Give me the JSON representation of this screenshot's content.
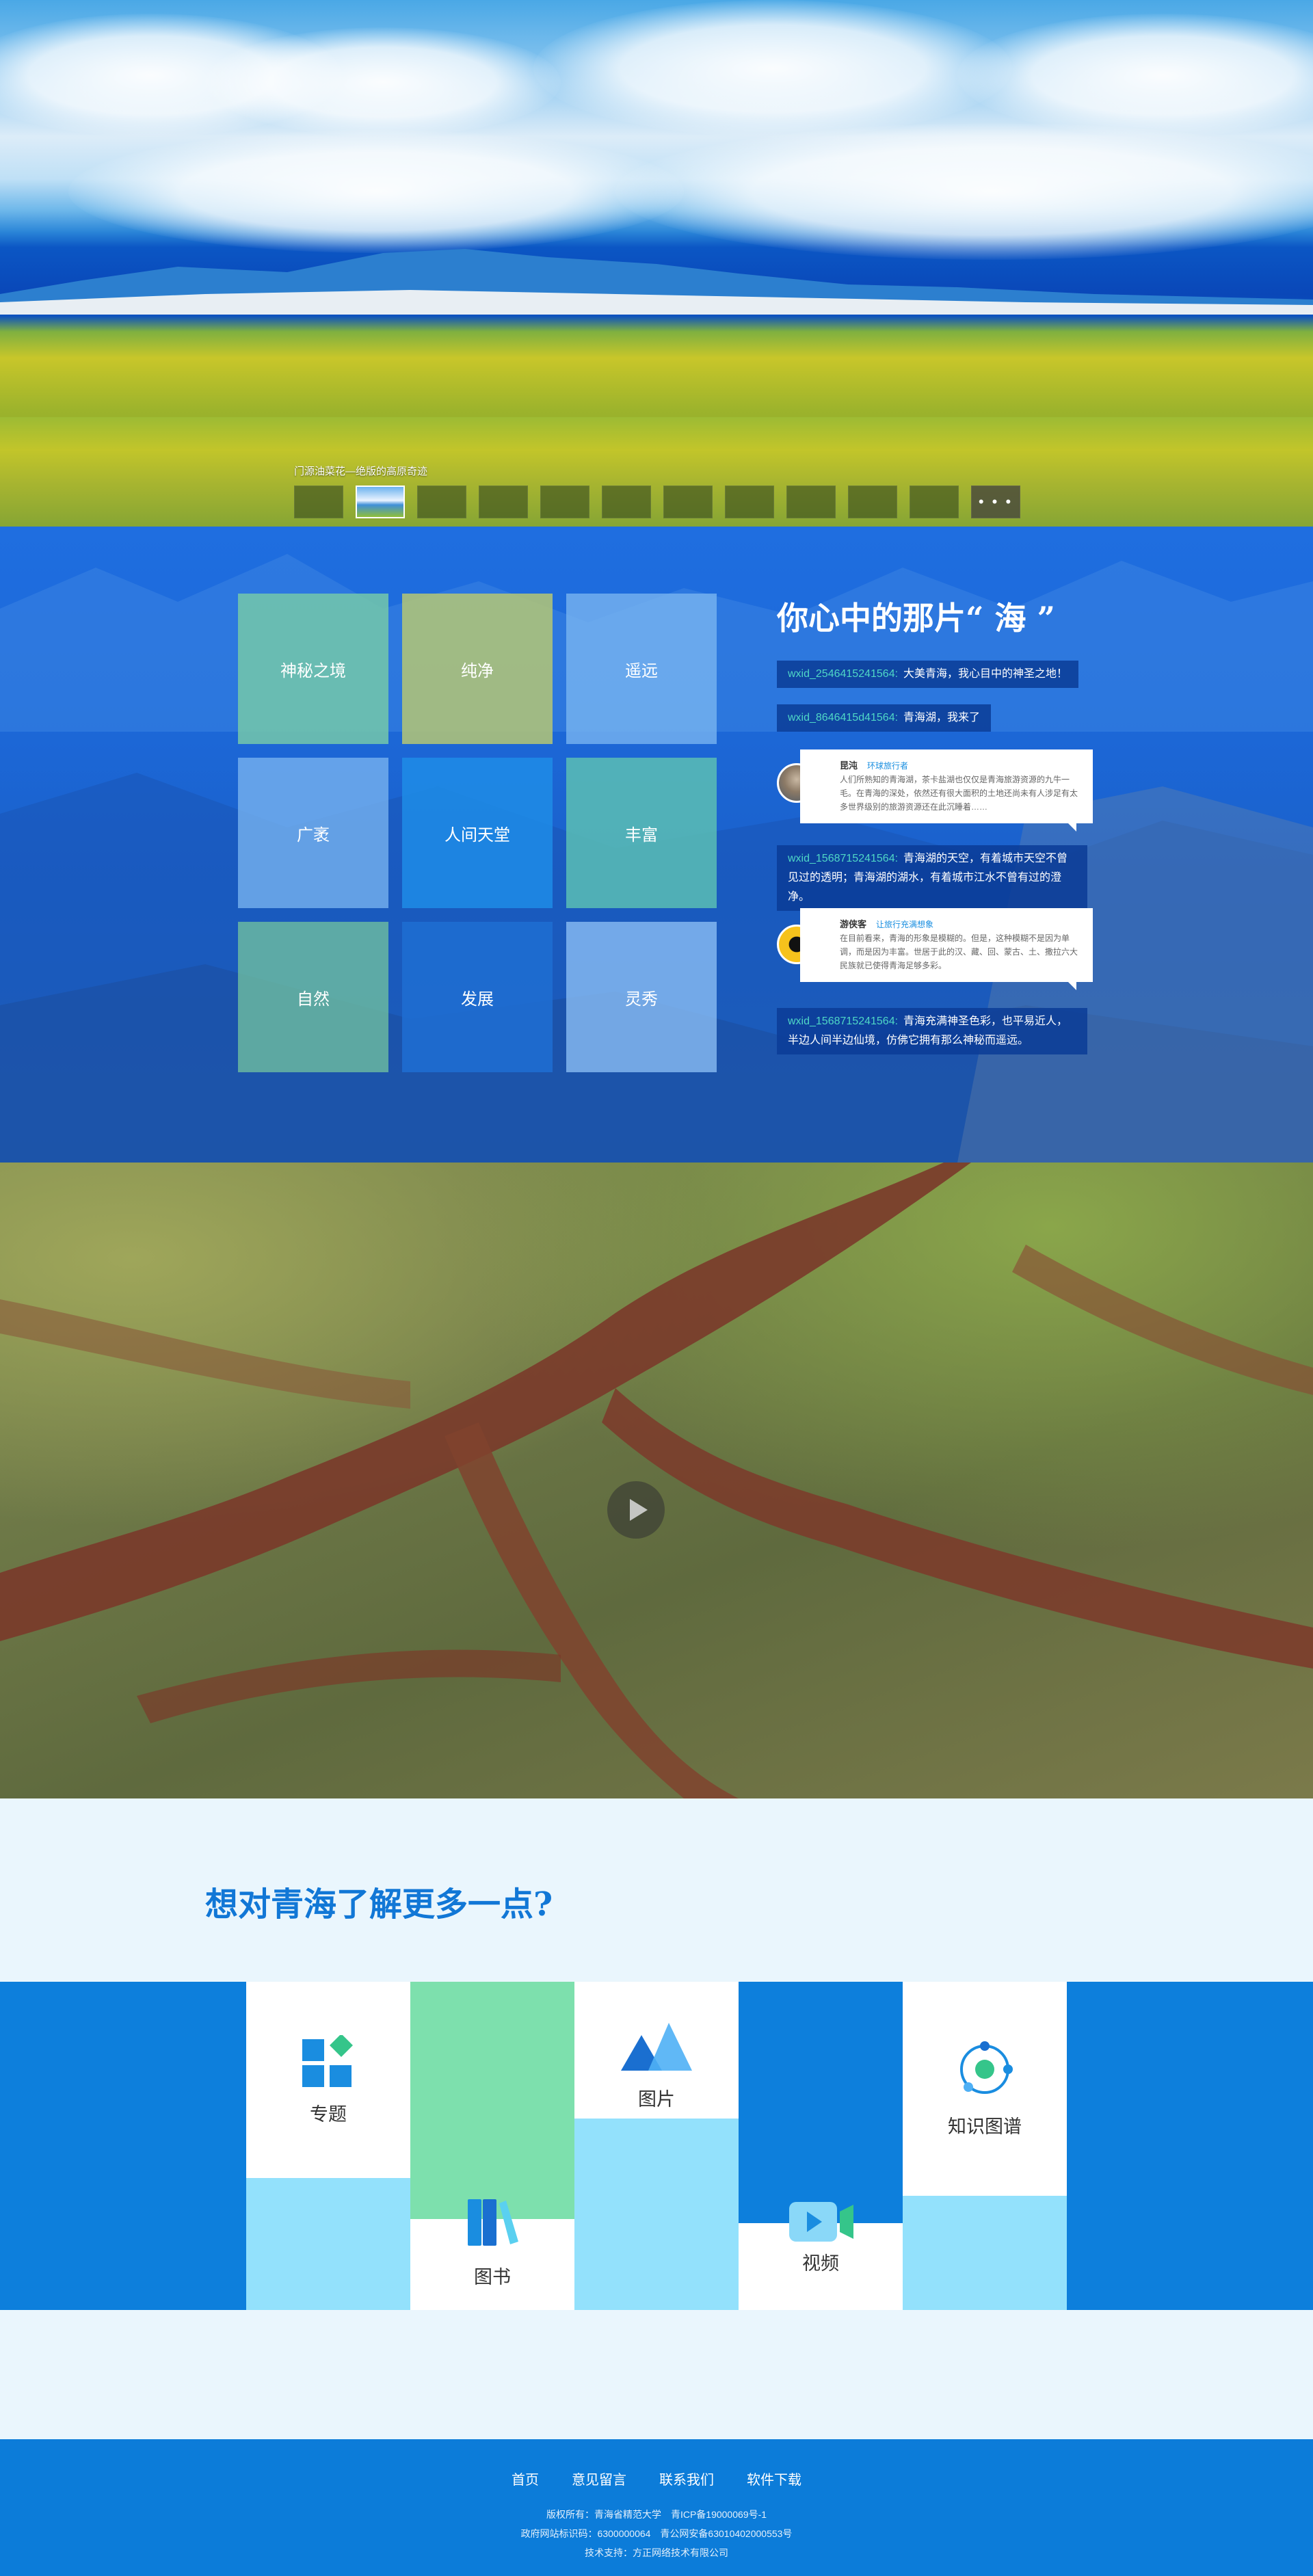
{
  "hero": {
    "caption": "门源油菜花—绝版的高原奇迹",
    "more_label": "• • •"
  },
  "sea": {
    "tiles": [
      "神秘之境",
      "纯净",
      "遥远",
      "广袤",
      "人间天堂",
      "丰富",
      "自然",
      "发展",
      "灵秀"
    ],
    "title": "你心中的那片“ 海 ”",
    "messages": [
      {
        "uid": "wxid_2546415241564:",
        "text": "大美青海，我心目中的神圣之地！"
      },
      {
        "uid": "wxid_8646415d41564:",
        "text": "青海湖，我来了"
      },
      {
        "uid": "wxid_1568715241564:",
        "text": "青海湖的天空，有着城市天空不曾见过的透明；青海湖的湖水，有着城市江水不曾有过的澄净。"
      },
      {
        "uid": "wxid_1568715241564:",
        "text": "青海充满神圣色彩，也平易近人，半边人间半边仙境，仿佛它拥有那么神秘而遥远。"
      }
    ],
    "cards": [
      {
        "name": "昆沌",
        "tag": "环球旅行者",
        "text": "人们所熟知的青海湖，茶卡盐湖也仅仅是青海旅游资源的九牛一毛。在青海的深处，依然还有很大面积的土地还尚未有人涉足有太多世界级别的旅游资源还在此沉睡着……"
      },
      {
        "name": "游侠客",
        "tag": "让旅行充满想象",
        "text": "在目前看来，青海的形象是模糊的。但是，这种模糊不是因为单调，而是因为丰富。世居于此的汉、藏、回、蒙古、土、撒拉六大民族就已使得青海足够多彩。"
      }
    ]
  },
  "learn": {
    "title": "想对青海了解更多一点?",
    "items": {
      "topic": "专题",
      "book": "图书",
      "picture": "图片",
      "video": "视频",
      "graph": "知识图谱"
    }
  },
  "footer": {
    "nav": [
      "首页",
      "意见留言",
      "联系我们",
      "软件下载"
    ],
    "copyright": "版权所有：青海省精范大学　青ICP备19000069号-1",
    "gov": "政府网站标识码：6300000064　青公网安备63010402000553号",
    "support": "技术支持：方正网络技术有限公司"
  },
  "colors": {
    "primary": "#0d7fdc",
    "light_blue": "#93e1fc",
    "mint": "#7de0ad",
    "uid": "#4fd7c6"
  }
}
